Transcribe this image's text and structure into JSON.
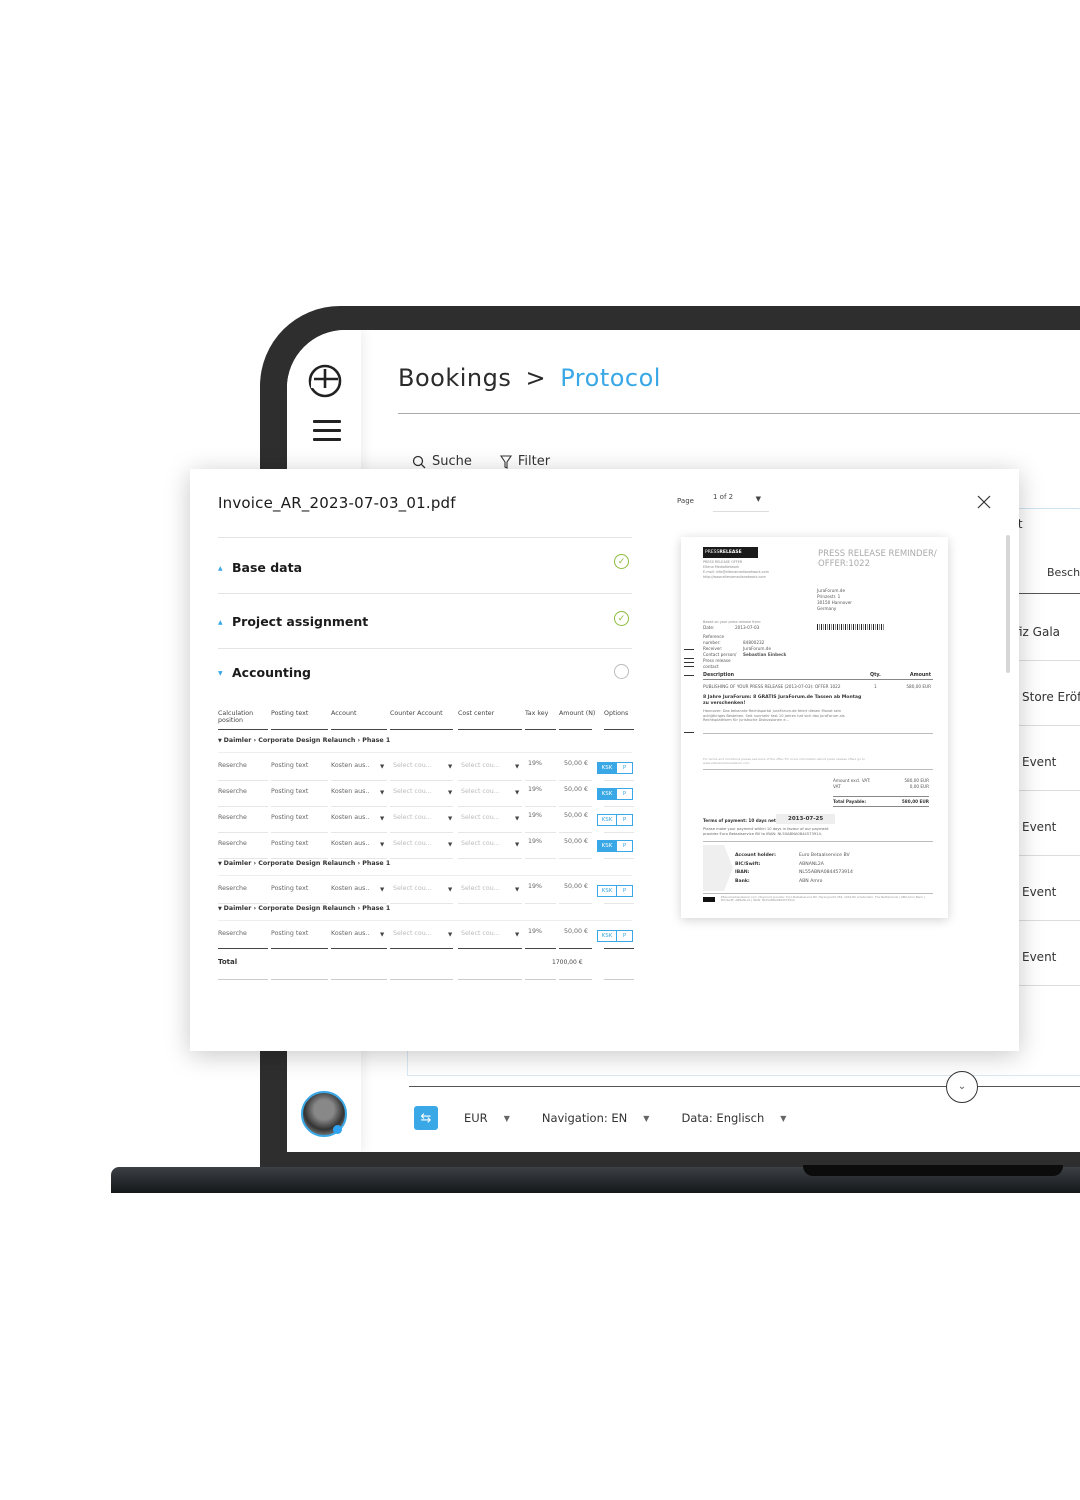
{
  "app": {
    "breadcrumb": {
      "root": "Bookings",
      "separator": ">",
      "current": "Protocol"
    },
    "toolbar": {
      "search_label": "Suche",
      "filter_label": "Filter"
    },
    "background_table": {
      "tab_partial_label": "rt",
      "column_partial_header": "Beschr",
      "rows": [
        "fiz Gala",
        "Store Eröff",
        "Event",
        "Event",
        "Event",
        "Event"
      ]
    },
    "footer": {
      "currency": "EUR",
      "navigation_language": "Navigation: EN",
      "data_language": "Data: Englisch"
    },
    "accent_color": "#3aa8e6"
  },
  "modal": {
    "title": "Invoice_AR_2023-07-03_01.pdf",
    "page_label": "Page",
    "page_value": "1 of 2",
    "sections": [
      {
        "label": "Base data",
        "status": "complete",
        "expanded": false
      },
      {
        "label": "Project assignment",
        "status": "complete",
        "expanded": false
      },
      {
        "label": "Accounting",
        "status": "incomplete",
        "expanded": true
      }
    ],
    "accounting": {
      "columns": [
        "Calculation position",
        "Posting text",
        "Account",
        "Counter Account",
        "Cost center",
        "Tax key",
        "Amount (N)",
        "Options"
      ],
      "groups": [
        {
          "label": "Daimler › Corporate Design Relaunch › Phase 1",
          "rows": [
            {
              "position": "Reserche",
              "posting_text": "Posting text",
              "account": "Kosten aus..",
              "counter_account": "Select cou...",
              "cost_center": "Select cou...",
              "tax_key": "19%",
              "amount": "50,00 €",
              "option_ksk": "KSK",
              "option_p": "P",
              "ksk_active": true
            },
            {
              "position": "Reserche",
              "posting_text": "Posting text",
              "account": "Kosten aus..",
              "counter_account": "Select cou...",
              "cost_center": "Select cou...",
              "tax_key": "19%",
              "amount": "50,00 €",
              "option_ksk": "KSK",
              "option_p": "P",
              "ksk_active": true
            },
            {
              "position": "Reserche",
              "posting_text": "Posting text",
              "account": "Kosten aus..",
              "counter_account": "Select cou...",
              "cost_center": "Select cou...",
              "tax_key": "19%",
              "amount": "50,00 €",
              "option_ksk": "KSK",
              "option_p": "P",
              "ksk_active": false
            },
            {
              "position": "Reserche",
              "posting_text": "Posting text",
              "account": "Kosten aus..",
              "counter_account": "Select cou...",
              "cost_center": "Select cou...",
              "tax_key": "19%",
              "amount": "50,00 €",
              "option_ksk": "KSK",
              "option_p": "P",
              "ksk_active": true
            }
          ]
        },
        {
          "label": "Daimler › Corporate Design Relaunch › Phase 1",
          "rows": [
            {
              "position": "Reserche",
              "posting_text": "Posting text",
              "account": "Kosten aus..",
              "counter_account": "Select cou...",
              "cost_center": "Select cou...",
              "tax_key": "19%",
              "amount": "50,00 €",
              "option_ksk": "KSK",
              "option_p": "P",
              "ksk_active": false
            }
          ]
        },
        {
          "label": "Daimler › Corporate Design Relaunch › Phase 1",
          "rows": [
            {
              "position": "Reserche",
              "posting_text": "Posting text",
              "account": "Kosten aus..",
              "counter_account": "Select cou...",
              "cost_center": "Select cou...",
              "tax_key": "19%",
              "amount": "50,00 €",
              "option_ksk": "KSK",
              "option_p": "P",
              "ksk_active": false
            }
          ]
        }
      ],
      "total_label": "Total",
      "total_value": "1700,00 €"
    },
    "pdf_preview": {
      "logo_text_light": "PRESS",
      "logo_text_bold": "RELEASE",
      "sender_lines": [
        "PRESS RELEASE OFFER",
        "Eltena MediaNetwork",
        "E-mail: info@eltenamedianetwork.com",
        "http://www.eltenamedianetwork.com"
      ],
      "heading_line1": "PRESS RELEASE REMINDER/",
      "heading_line2": "OFFER:1022",
      "address_lines": [
        "JuraForum.de",
        "Prinzestr. 1",
        "30150 Hannover",
        "Germany"
      ],
      "date_note": "Based on your press release from:",
      "date_label": "Date:",
      "date_value": "2013-07-03",
      "meta": [
        {
          "k": "Reference number:",
          "v": "84800232"
        },
        {
          "k": "Receiver:",
          "v": "JuraForum.de"
        },
        {
          "k": "Contact person/",
          "v": "Sebastian Einbeck"
        },
        {
          "k": "Press release contact",
          "v": ""
        }
      ],
      "table_header": {
        "description": "Description",
        "qty": "Qty.",
        "amount": "Amount"
      },
      "line_item": {
        "description": "PUBLISHING OF YOUR PRESS RELEASE (2013-07-03): OFFER 1022",
        "qty": "1",
        "amount": "580,00 EUR"
      },
      "headline": "8 Jahre JuraForum: 8 GRATIS JuraForum.de Tassen ab Montag zu verschenken!",
      "blurb": "Hannover: Das bekannte Rechtsportal JuraForum.de feiert diesen Monat sein achtjähriges Bestehen. Seit nunmehr fast 10 Jahren hat sich das JuraForum als Rechtsplattform für juristische Diskussionen e...",
      "small_print": "For terms and conditions please see back of the offer. For more information about press release offers go to www.eltenamedianetwork.com",
      "amount_excl_vat_label": "Amount excl. VAT:",
      "amount_excl_vat": "580,00 EUR",
      "vat_label": "VAT",
      "vat": "0,00 EUR",
      "total_payable_label": "Total Payable:",
      "total_payable": "580,00 EUR",
      "terms_label": "Terms of payment: 10 days net",
      "due_date": "2013-07-25",
      "terms_note": "Please make your payment within 10 days in favour of our payment provider Euro Betaalservice BV to IBAN: NL55ABNA0844573914.",
      "bank": [
        {
          "k": "Account holder:",
          "v": "Euro Betaalservice BV"
        },
        {
          "k": "BIC/Swift:",
          "v": "ABNANL2A"
        },
        {
          "k": "IBAN:",
          "v": "NL55ABNA0844573914"
        },
        {
          "k": "Bank:",
          "v": "ABN Amro"
        }
      ],
      "footer_text": "Eltenamedianetwork.com | Payment provider: Euro Betaalservice BV, Herengracht 282, 1016 BX Amsterdam, The Netherlands | ABN Amro Bank | BIC/Swift: ABNANL2A | IBAN: NL55ABNA0844573914"
    }
  }
}
